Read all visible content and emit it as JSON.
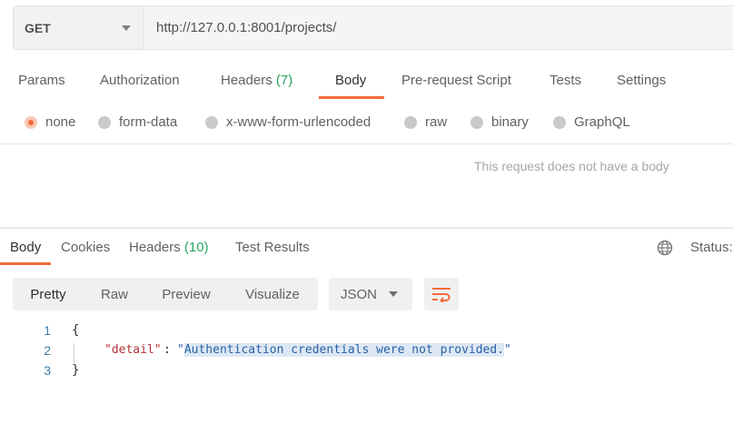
{
  "request": {
    "method": "GET",
    "url": "http://127.0.0.1:8001/projects/"
  },
  "request_tabs": [
    {
      "label": "Params"
    },
    {
      "label": "Authorization"
    },
    {
      "label": "Headers",
      "count": "(7)"
    },
    {
      "label": "Body",
      "active": true
    },
    {
      "label": "Pre-request Script"
    },
    {
      "label": "Tests"
    },
    {
      "label": "Settings"
    }
  ],
  "body_types": [
    {
      "label": "none",
      "selected": true
    },
    {
      "label": "form-data"
    },
    {
      "label": "x-www-form-urlencoded"
    },
    {
      "label": "raw"
    },
    {
      "label": "binary"
    },
    {
      "label": "GraphQL"
    }
  ],
  "no_body_message": "This request does not have a body",
  "response": {
    "tabs": [
      {
        "label": "Body",
        "active": true
      },
      {
        "label": "Cookies"
      },
      {
        "label": "Headers",
        "count": "(10)"
      },
      {
        "label": "Test Results"
      }
    ],
    "status_label": "Status:",
    "globe_icon": "globe-icon",
    "views": [
      "Pretty",
      "Raw",
      "Preview",
      "Visualize"
    ],
    "active_view": "Pretty",
    "format": "JSON",
    "wrap_icon": "wrap-lines-icon",
    "code": {
      "line_numbers": [
        "1",
        "2",
        "3"
      ],
      "open_brace": "{",
      "close_brace": "}",
      "key": "\"detail\"",
      "colon": ":",
      "value_open": "\"",
      "value_text": "Authentication credentials were not provided.",
      "value_close": "\""
    }
  },
  "colors": {
    "accent": "#f26b3a",
    "count_green": "#26a55f",
    "json_key": "#b4343a",
    "json_string": "#2a61a6",
    "line_number": "#3b7ea8"
  }
}
